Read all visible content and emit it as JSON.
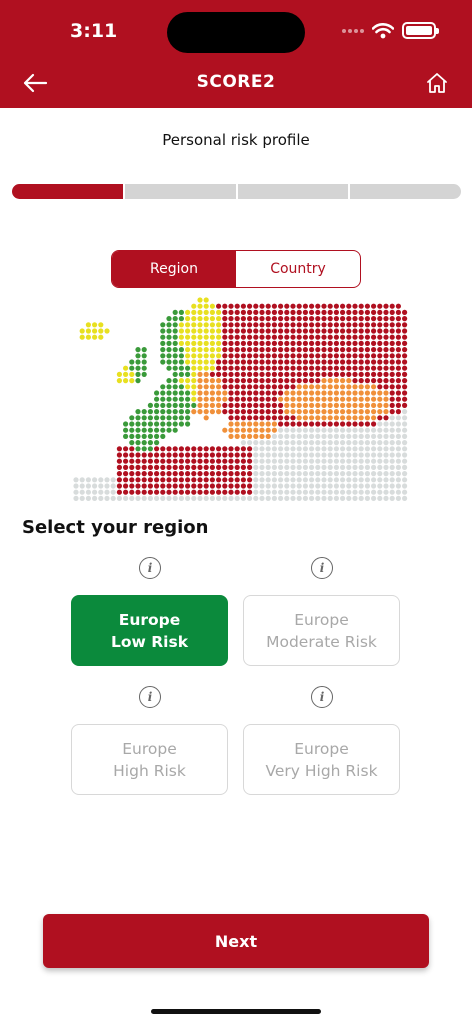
{
  "status_bar": {
    "time": "3:11"
  },
  "header": {
    "title": "SCORE2",
    "back_icon": "arrow-left-icon",
    "home_icon": "home-icon"
  },
  "page": {
    "section_title": "Personal risk profile"
  },
  "progress": {
    "total_steps": 4,
    "current_step": 1
  },
  "toggle": {
    "options": [
      "Region",
      "Country"
    ],
    "selected": "Region"
  },
  "map": {
    "legend_colors": {
      "low": "#3a9a3a",
      "moderate": "#e8e020",
      "high": "#f0903a",
      "very_high": "#b01020",
      "none": "#d8dcdc"
    }
  },
  "region_select": {
    "heading": "Select your region",
    "options": [
      {
        "line1": "Europe",
        "line2": "Low Risk",
        "selected": true
      },
      {
        "line1": "Europe",
        "line2": "Moderate Risk",
        "selected": false
      },
      {
        "line1": "Europe",
        "line2": "High Risk",
        "selected": false
      },
      {
        "line1": "Europe",
        "line2": "Very High Risk",
        "selected": false
      }
    ]
  },
  "footer": {
    "next_label": "Next"
  },
  "colors": {
    "brand": "#b01020",
    "selected": "#0b8a3c",
    "inactive": "#d4d4d4"
  }
}
